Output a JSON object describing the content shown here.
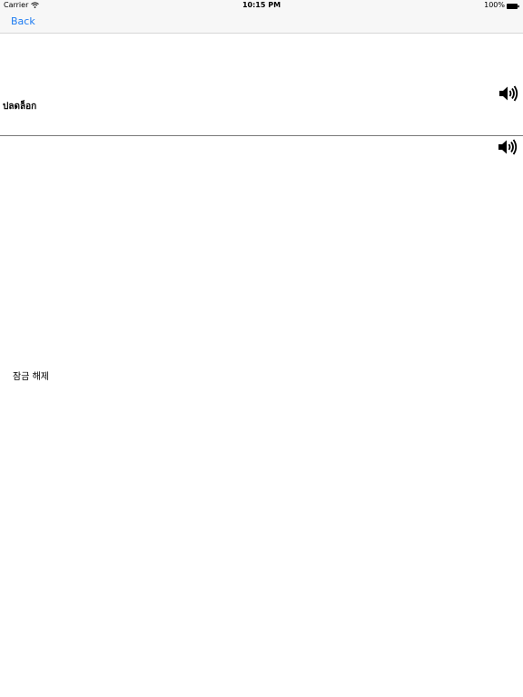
{
  "status_bar": {
    "carrier": "Carrier",
    "time": "10:15 PM",
    "battery": "100%"
  },
  "nav": {
    "back_label": "Back"
  },
  "entry": {
    "source_text": "ปลดล็อก",
    "translation_text": "잠금 해제"
  },
  "icons": {
    "wifi": "wifi-icon",
    "battery": "battery-icon",
    "speaker": "speaker-icon"
  },
  "colors": {
    "accent": "#1e7cf2",
    "bar_background": "#f7f7f7",
    "divider": "#7a7a7a"
  }
}
